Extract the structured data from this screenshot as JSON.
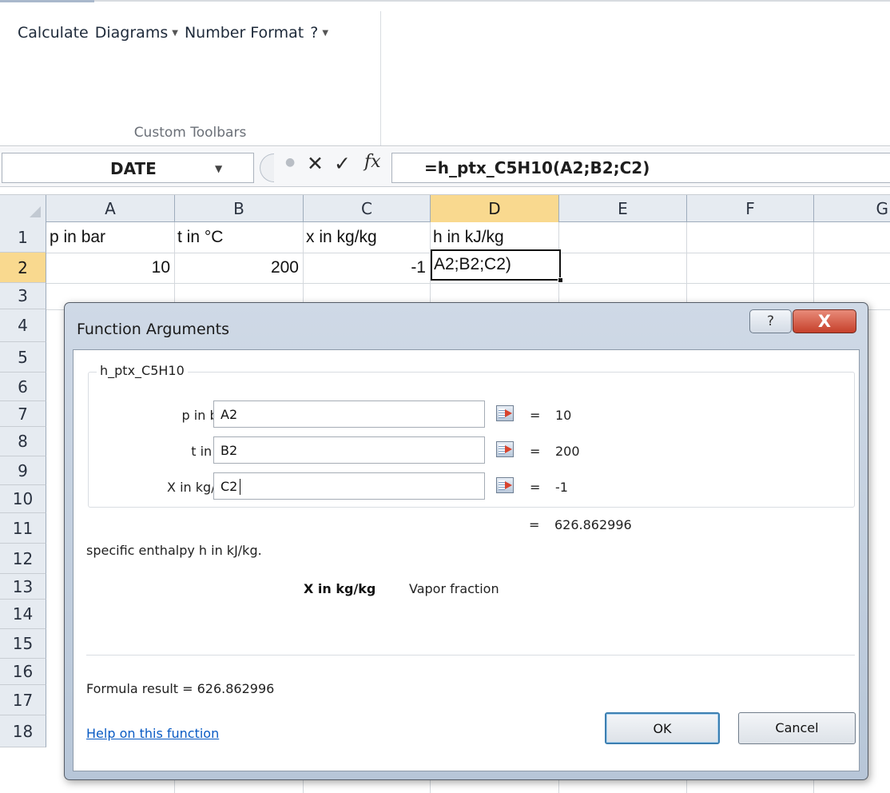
{
  "ribbon": {
    "menu": [
      {
        "label": "Calculate",
        "dropdown": false
      },
      {
        "label": "Diagrams",
        "dropdown": true
      },
      {
        "label": "Number Format",
        "dropdown": false
      },
      {
        "label": "?",
        "dropdown": true
      }
    ],
    "group_label": "Custom Toolbars"
  },
  "formula_bar": {
    "name_box": "DATE",
    "formula": "=h_ptx_C5H10(A2;B2;C2)",
    "icons": {
      "cancel": "close-icon",
      "enter": "check-icon",
      "function": "fx-icon"
    }
  },
  "grid": {
    "columns": [
      "A",
      "B",
      "C",
      "D",
      "E",
      "F",
      "G"
    ],
    "active_column": "D",
    "rows": [
      "1",
      "2",
      "3",
      "4",
      "5",
      "6",
      "7",
      "8",
      "9",
      "10",
      "11",
      "12",
      "13",
      "14",
      "15",
      "16",
      "17",
      "18"
    ],
    "active_row": "2",
    "row1": {
      "A": "p in bar",
      "B": "t in °C",
      "C": "x in kg/kg",
      "D": "h in kJ/kg"
    },
    "row2": {
      "A": "10",
      "B": "200",
      "C": "-1",
      "D": "A2;B2;C2)"
    }
  },
  "dialog": {
    "title": "Function Arguments",
    "help_button": "?",
    "close_button": "X",
    "function_name": "h_ptx_C5H10",
    "args": [
      {
        "label": "p in bar",
        "value": "A2",
        "result": "10"
      },
      {
        "label": "t in ºC",
        "value": "B2",
        "result": "200"
      },
      {
        "label": "X in kg/kg",
        "value": "C2",
        "result": "-1"
      }
    ],
    "equals": "=",
    "result": "626.862996",
    "description": "specific enthalpy h in kJ/kg.",
    "arg_help_name": "X in kg/kg",
    "arg_help_desc": "Vapor fraction",
    "formula_result": "Formula result =   626.862996",
    "help_link": "Help on this function",
    "ok": "OK",
    "cancel": "Cancel"
  },
  "colors": {
    "header_bg": "#e6ebf1",
    "active_header": "#f9d98f",
    "dialog_frame": "#c0cddd",
    "close_button": "#c6402b",
    "link": "#0a5bc4"
  }
}
